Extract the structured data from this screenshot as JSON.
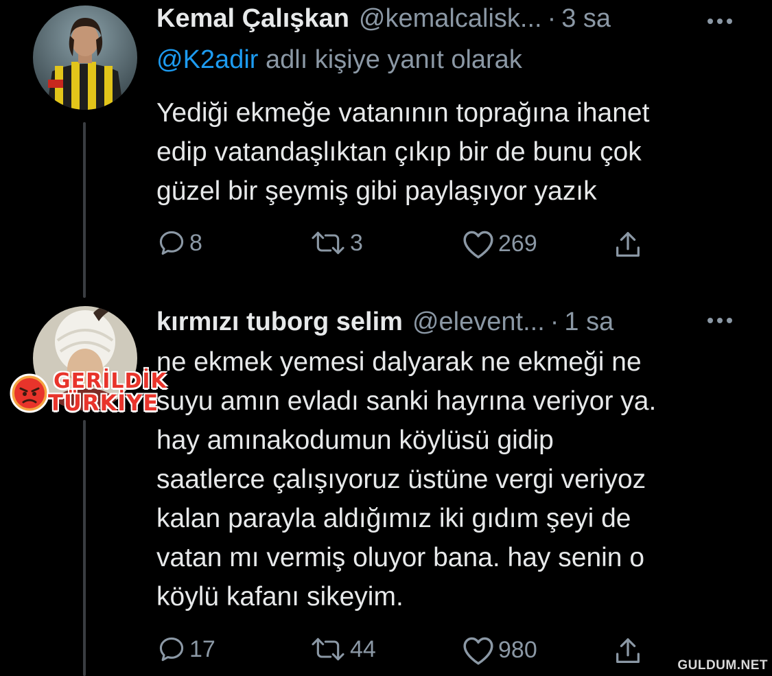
{
  "tweet1": {
    "name": "Kemal Çalışkan",
    "handle": "@kemalcalisk...",
    "separator": "·",
    "time": "3 sa",
    "reply_mention": "@K2adir",
    "reply_suffix": " adlı kişiye yanıt olarak",
    "lines": [
      "Yediği ekmeğe vatanının toprağına ihanet",
      "edip vatandaşlıktan çıkıp bir de bunu çok",
      "güzel bir şeymiş gibi paylaşıyor yazık"
    ],
    "replies": "8",
    "retweets": "3",
    "likes": "269"
  },
  "tweet2": {
    "name": "kırmızı tuborg selim",
    "handle": "@elevent...",
    "separator": "·",
    "time": "1 sa",
    "lines": [
      "ne ekmek yemesi dalyarak ne ekmeği ne",
      "suyu amın evladı sanki hayrına veriyor ya.",
      "hay amınakodumun köylüsü gidip",
      "saatlerce çalışıyoruz üstüne vergi veriyoz",
      "kalan parayla aldığımız iki gıdım şeyi de",
      "vatan mı vermiş oluyor bana. hay senin o",
      "köylü kafanı sikeyim."
    ],
    "replies": "17",
    "retweets": "44",
    "likes": "980"
  },
  "stamp": {
    "line1": "GERİLDİK",
    "line2": "TÜRKİYE"
  },
  "watermark": "GULDUM.NET",
  "colors": {
    "background": "#000000",
    "text": "#e7e9ea",
    "muted": "#8b98a5",
    "link": "#1d9bf0"
  },
  "icons": [
    "reply-icon",
    "retweet-icon",
    "like-icon",
    "share-icon",
    "more-icon"
  ]
}
